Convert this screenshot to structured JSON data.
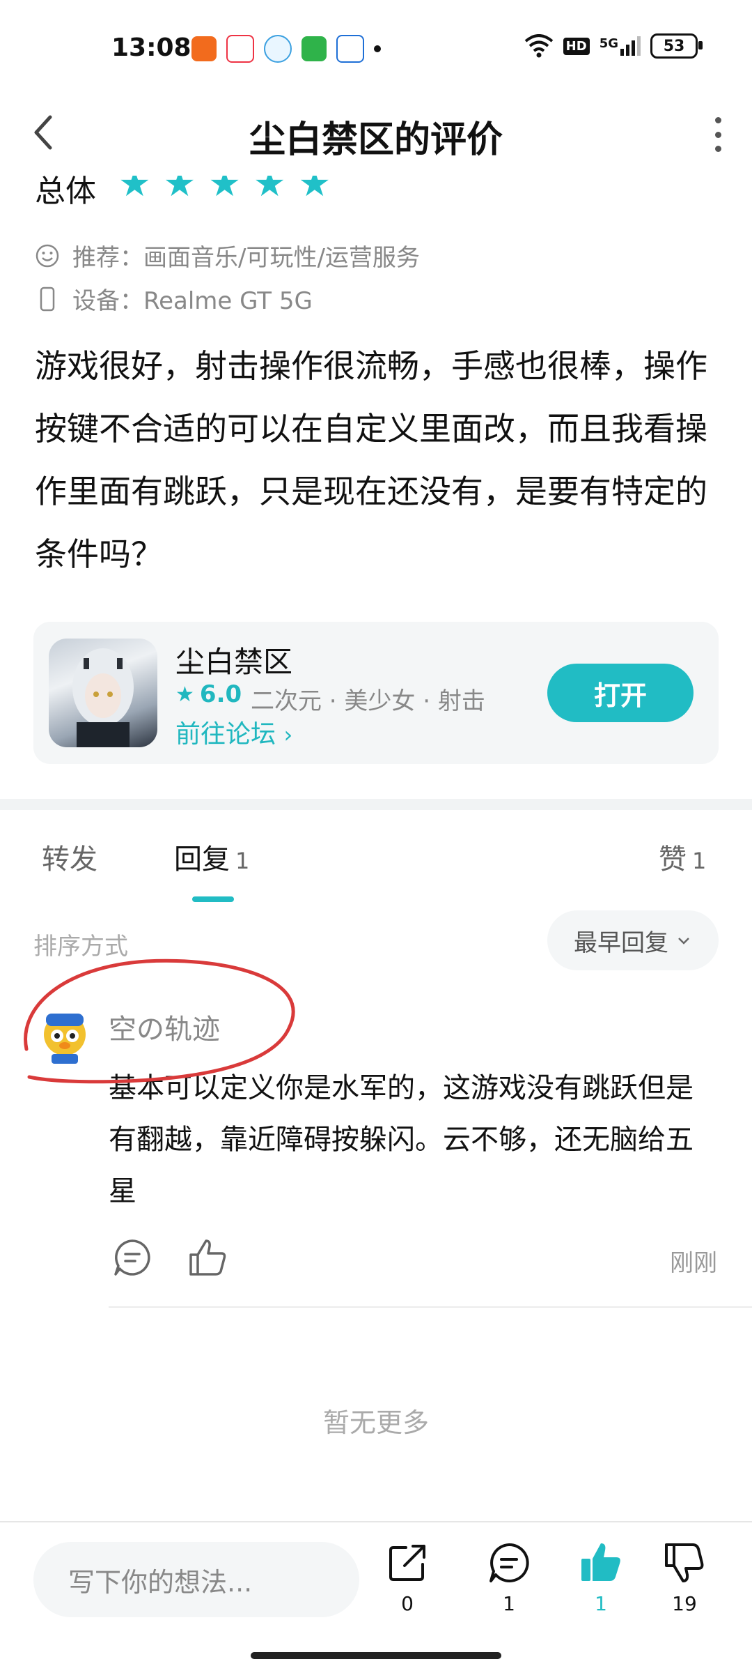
{
  "status": {
    "time": "13:08",
    "battery": "53",
    "network": "5G",
    "hd": "HD"
  },
  "header": {
    "title": "尘白禁区的评价"
  },
  "review": {
    "rating_label": "总体",
    "stars": 5,
    "recommend_label": "推荐：",
    "recommend_value": "画面音乐/可玩性/运营服务",
    "device_label": "设备：",
    "device_value": "Realme GT 5G",
    "text": "游戏很好，射击操作很流畅，手感也很棒，操作按键不合适的可以在自定义里面改，而且我看操作里面有跳跃，只是现在还没有，是要有特定的条件吗？"
  },
  "app_card": {
    "name": "尘白禁区",
    "score": "6.0",
    "tags": "二次元 · 美少女 · 射击",
    "forum_link": "前往论坛",
    "open_label": "打开"
  },
  "tabs": {
    "forward": "转发",
    "reply": "回复",
    "reply_count": "1",
    "like": "赞",
    "like_count": "1"
  },
  "sort": {
    "label": "排序方式",
    "value": "最早回复"
  },
  "reply": {
    "user": "空の轨迹",
    "text": "基本可以定义你是水军的，这游戏没有跳跃但是有翻越，靠近障碍按躲闪。云不够，还无脑给五星",
    "time": "刚刚"
  },
  "no_more": "暂无更多",
  "bottom_bar": {
    "input_placeholder": "写下你的想法...",
    "share_count": "0",
    "comment_count": "1",
    "like_count": "1",
    "dislike_count": "19"
  },
  "colors": {
    "accent": "#21bcc4",
    "annotation": "#d93a3a"
  }
}
